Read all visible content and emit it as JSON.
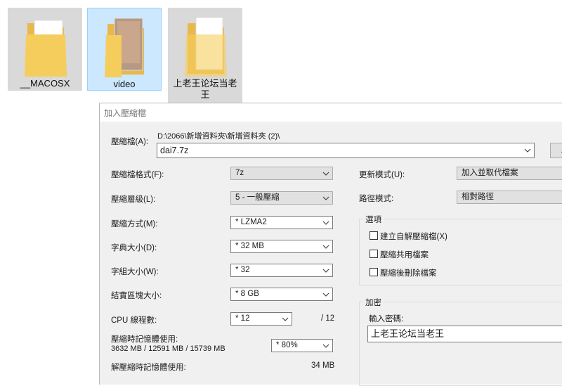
{
  "desktop": {
    "folders": [
      {
        "name": "__MACOSX"
      },
      {
        "name": "video"
      },
      {
        "name": "上老王论坛当老王"
      }
    ]
  },
  "dialog": {
    "title": "加入壓縮檔",
    "archive": {
      "label": "壓縮檔(A):",
      "path": "D:\\2066\\新增資料夾\\新增資料夾 (2)\\",
      "filename": "dai7.7z",
      "browse": "..."
    },
    "left": {
      "format_label": "壓縮檔格式(F):",
      "format_value": "7z",
      "level_label": "壓縮層級(L):",
      "level_value": "5 - 一般壓縮",
      "method_label": "壓縮方式(M):",
      "method_value": "* LZMA2",
      "dict_label": "字典大小(D):",
      "dict_value": "* 32 MB",
      "word_label": "字組大小(W):",
      "word_value": "* 32",
      "solid_label": "結實區塊大小:",
      "solid_value": "* 8 GB",
      "cpu_label": "CPU 線程數:",
      "cpu_value": "* 12",
      "cpu_total": "/ 12",
      "mem_label": "壓縮時記憶體使用:",
      "mem_detail": "3632 MB / 12591 MB / 15739 MB",
      "mem_value": "* 80%",
      "decomp_label": "解壓縮時記憶體使用:",
      "decomp_value": "34 MB"
    },
    "right": {
      "update_label": "更新模式(U):",
      "update_value": "加入並取代檔案",
      "path_label": "路徑模式:",
      "path_value": "相對路徑",
      "options_title": "選項",
      "options": [
        {
          "label": "建立自解壓縮檔(X)",
          "checked": false
        },
        {
          "label": "壓縮共用檔案",
          "checked": false
        },
        {
          "label": "壓縮後刪除檔案",
          "checked": false
        }
      ],
      "encrypt_title": "加密",
      "password_label": "輸入密碼:",
      "password_value": "上老王论坛当老王"
    }
  }
}
